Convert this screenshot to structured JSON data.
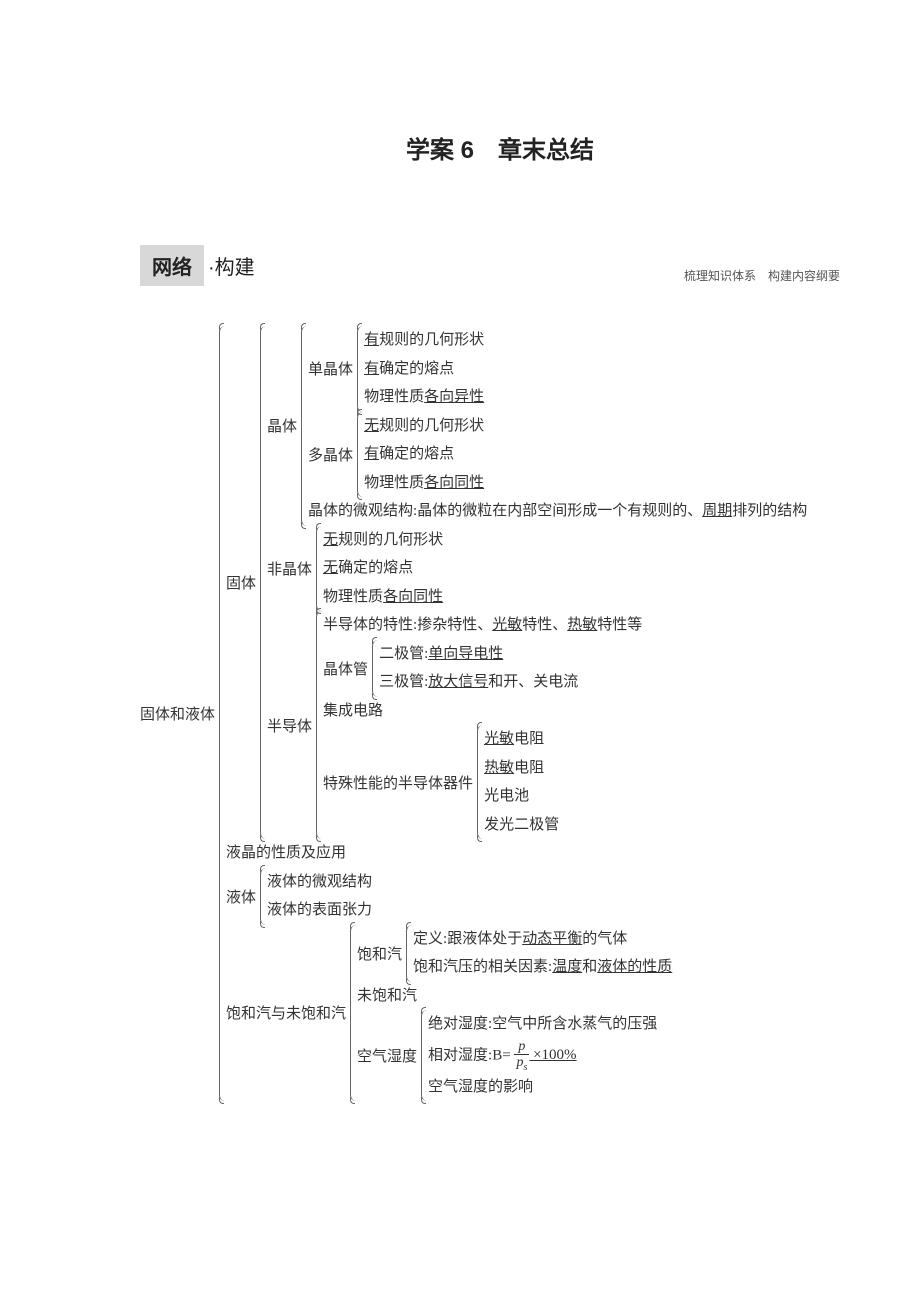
{
  "title": "学案 6　章末总结",
  "section": {
    "box": "网络",
    "sub": "·构建",
    "right": "梳理知识体系　构建内容纲要"
  },
  "root": "固体和液体",
  "solid": {
    "label": "固体",
    "crystal": {
      "label": "晶体",
      "single": {
        "label": "单晶体",
        "a": "规则的几何形状",
        "a_u": "有",
        "b": "确定的熔点",
        "b_u": "有",
        "c": "物理性质",
        "c_u": "各向异性"
      },
      "poly": {
        "label": "多晶体",
        "a": "规则的几何形状",
        "a_u": "无",
        "b": "确定的熔点",
        "b_u": "有",
        "c": "物理性质",
        "c_u": "各向同性"
      },
      "micro_pre": "晶体的微观结构:晶体的微粒在内部空间形成一个有规则的、",
      "micro_u": "周期",
      "micro_suf": "排列的结构"
    },
    "amorphous": {
      "label": "非晶体",
      "a": "规则的几何形状",
      "a_u": "无",
      "b": "确定的熔点",
      "b_u": "无",
      "c": "物理性质",
      "c_u": "各向同性"
    },
    "semi": {
      "label": "半导体",
      "feat_pre": "半导体的特性:掺杂特性、",
      "feat_u1": "光敏",
      "feat_mid": "特性、",
      "feat_u2": "热敏",
      "feat_suf": "特性等",
      "transistor": {
        "label": "晶体管",
        "diode_pre": "二极管:",
        "diode_u": "单向导电性",
        "triode_pre": "三极管:",
        "triode_u": "放大信号",
        "triode_suf": "和开、关电流"
      },
      "ic": "集成电路",
      "special": {
        "label": "特殊性能的半导体器件",
        "a_u": "光敏",
        "a_suf": "电阻",
        "b_u": "热敏",
        "b_suf": "电阻",
        "c": "光电池",
        "d": "发光二极管"
      }
    }
  },
  "lcd": "液晶的性质及应用",
  "liquid": {
    "label": "液体",
    "a": "液体的微观结构",
    "b": "液体的表面张力"
  },
  "vapor": {
    "label": "饱和汽与未饱和汽",
    "sat": {
      "label": "饱和汽",
      "def_pre": "定义:跟液体处于",
      "def_u": "动态平衡",
      "def_suf": "的气体",
      "factor_pre": "饱和汽压的相关因素:",
      "factor_u1": "温度",
      "factor_mid": "和",
      "factor_u2": "液体的性质"
    },
    "unsat": "未饱和汽",
    "humidity": {
      "label": "空气湿度",
      "abs": "绝对湿度:空气中所含水蒸气的压强",
      "rel_pre": "相对湿度:B=",
      "rel_num": "p",
      "rel_den": "p",
      "rel_den_sub": "s",
      "rel_suf": "×100%",
      "eff": "空气湿度的影响"
    }
  }
}
